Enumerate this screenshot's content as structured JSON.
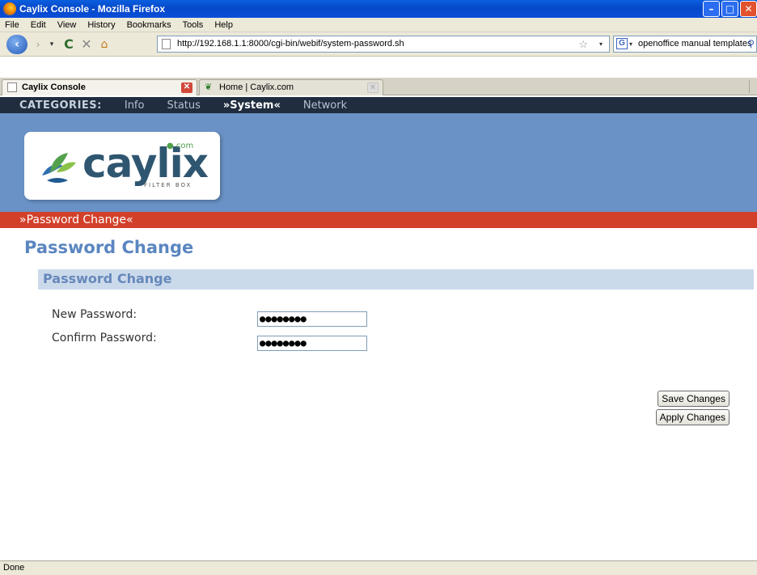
{
  "window": {
    "title": "Caylix Console - Mozilla Firefox",
    "minimize": "–",
    "maximize": "□",
    "close": "✕"
  },
  "menu": [
    "File",
    "Edit",
    "View",
    "History",
    "Bookmarks",
    "Tools",
    "Help"
  ],
  "navigation": {
    "back": "‹",
    "forward": "›",
    "dropdown": "▾",
    "reload": "C",
    "stop": "✕",
    "home": "⌂",
    "url": "http://192.168.1.1:8000/cgi-bin/webif/system-password.sh",
    "bookmark_star": "☆",
    "search_engine": "G",
    "search_query": "openoffice manual templates",
    "search_go": "⚲"
  },
  "tabs": [
    {
      "label": "Caylix Console",
      "close": "✕",
      "active": true
    },
    {
      "label": "Home | Caylix.com",
      "close": "✕",
      "active": false
    }
  ],
  "categories": {
    "label": "CATEGORIES:",
    "items": [
      "Info",
      "Status",
      "»System«",
      "Network"
    ],
    "current": "»System«"
  },
  "logo": {
    "text": "caylix",
    "com": "● com",
    "sub": "FILTER BOX"
  },
  "breadcrumb": "»Password Change«",
  "page": {
    "title": "Password Change",
    "section_title": "Password Change",
    "fields": [
      {
        "label": "New Password:",
        "value": "●●●●●●●●"
      },
      {
        "label": "Confirm Password:",
        "value": "●●●●●●●●"
      }
    ],
    "buttons": {
      "save": "Save Changes",
      "apply": "Apply Changes"
    }
  },
  "status": "Done",
  "colors": {
    "categories_bg": "#1f2d3f",
    "header_bg": "#6a92c6",
    "breadcrumb_bg": "#d2402a",
    "title_color": "#5b86c0",
    "section_bg": "#cbdaeb"
  }
}
